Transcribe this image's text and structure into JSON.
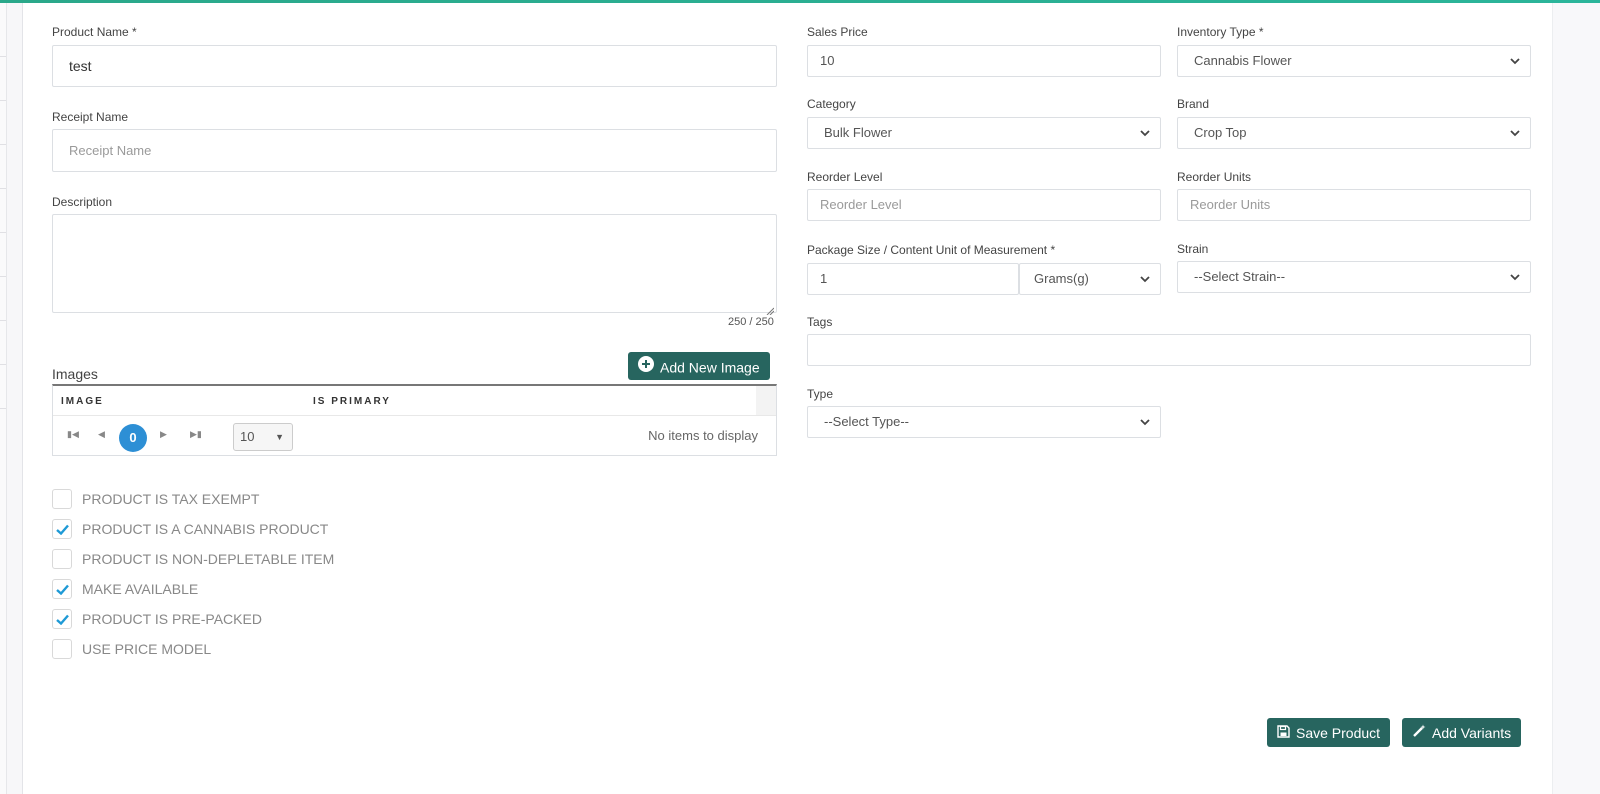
{
  "colors": {
    "accent": "#27655f",
    "topbar": "#2bb59a",
    "pager_active": "#2d8fd5",
    "check": "#1e9ad6"
  },
  "left": {
    "product_name": {
      "label": "Product Name *",
      "value": "test"
    },
    "receipt_name": {
      "label": "Receipt Name",
      "placeholder": "Receipt Name",
      "value": ""
    },
    "description": {
      "label": "Description",
      "value": "",
      "char_count": "250 / 250"
    },
    "images": {
      "title": "Images",
      "add_button": "Add New Image",
      "columns": [
        "IMAGE",
        "IS PRIMARY"
      ],
      "pager": {
        "first_icon": "first-page-icon",
        "prev_icon": "prev-page-icon",
        "current_page": "0",
        "next_icon": "next-page-icon",
        "last_icon": "last-page-icon",
        "page_size": "10",
        "empty_message": "No items to display"
      }
    },
    "checkboxes": [
      {
        "label": "PRODUCT IS TAX EXEMPT",
        "checked": false
      },
      {
        "label": "PRODUCT IS A CANNABIS PRODUCT",
        "checked": true
      },
      {
        "label": "PRODUCT IS NON-DEPLETABLE ITEM",
        "checked": false
      },
      {
        "label": "MAKE AVAILABLE",
        "checked": true
      },
      {
        "label": "PRODUCT IS PRE-PACKED",
        "checked": true
      },
      {
        "label": "USE PRICE MODEL",
        "checked": false
      }
    ]
  },
  "right": {
    "sales_price": {
      "label": "Sales Price",
      "value": "10"
    },
    "inventory_type": {
      "label": "Inventory Type *",
      "value": "Cannabis Flower"
    },
    "category": {
      "label": "Category",
      "value": "Bulk Flower"
    },
    "brand": {
      "label": "Brand",
      "value": "Crop Top"
    },
    "reorder_level": {
      "label": "Reorder Level",
      "placeholder": "Reorder Level",
      "value": ""
    },
    "reorder_units": {
      "label": "Reorder Units",
      "placeholder": "Reorder Units",
      "value": ""
    },
    "package_size": {
      "label": "Package Size / Content Unit of Measurement *",
      "value": "1",
      "unit": "Grams(g)"
    },
    "strain": {
      "label": "Strain",
      "value": "--Select Strain--"
    },
    "tags": {
      "label": "Tags",
      "value": ""
    },
    "type": {
      "label": "Type",
      "value": "--Select Type--"
    }
  },
  "footer": {
    "save_button": "Save Product",
    "add_variants_button": "Add Variants"
  }
}
